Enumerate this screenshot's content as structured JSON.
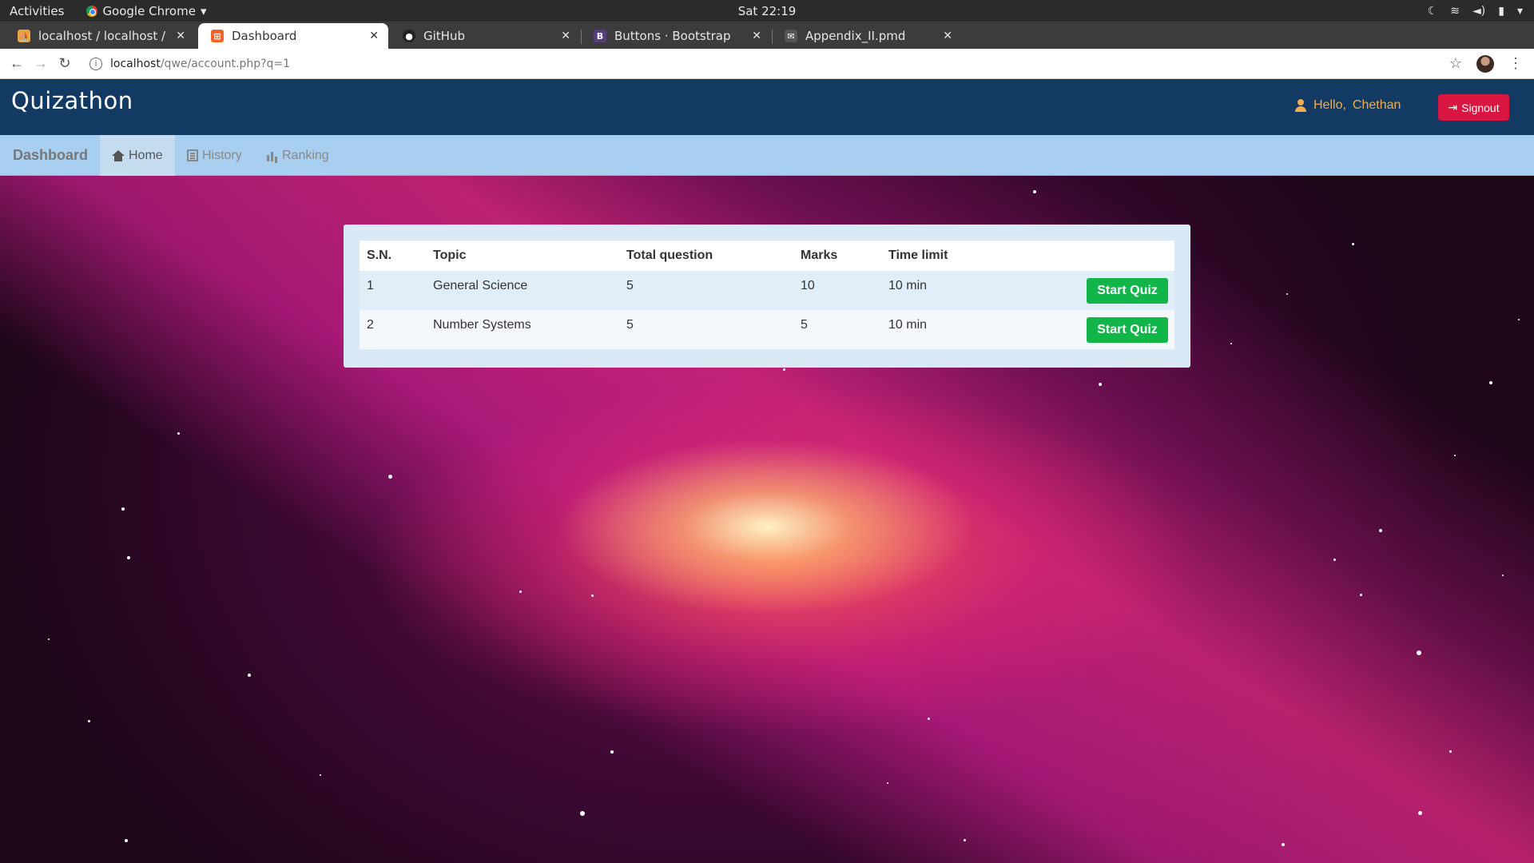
{
  "os": {
    "activities": "Activities",
    "app_name": "Google Chrome",
    "clock": "Sat 22:19"
  },
  "browser": {
    "tabs": [
      {
        "title": "localhost / localhost / pro",
        "active": false
      },
      {
        "title": "Dashboard",
        "active": true
      },
      {
        "title": "GitHub",
        "active": false
      },
      {
        "title": "Buttons · Bootstrap",
        "active": false
      },
      {
        "title": "Appendix_II.pmd",
        "active": false
      }
    ],
    "url_host": "localhost",
    "url_path": "/qwe/account.php?q=1"
  },
  "header": {
    "logo": "Quizathon",
    "hello_prefix": "Hello,",
    "username": "Chethan",
    "signout_label": "Signout"
  },
  "nav": {
    "brand": "Dashboard",
    "links": [
      {
        "label": "Home",
        "icon": "home-icon",
        "active": true
      },
      {
        "label": "History",
        "icon": "list-icon",
        "active": false
      },
      {
        "label": "Ranking",
        "icon": "bar-chart-icon",
        "active": false
      }
    ]
  },
  "quiz_table": {
    "headers": [
      "S.N.",
      "Topic",
      "Total question",
      "Marks",
      "Time limit"
    ],
    "rows": [
      {
        "sn": "1",
        "topic": "General Science",
        "total_question": "5",
        "marks": "10",
        "time_limit": "10 min",
        "action": "Start Quiz"
      },
      {
        "sn": "2",
        "topic": "Number Systems",
        "total_question": "5",
        "marks": "5",
        "time_limit": "10 min",
        "action": "Start Quiz"
      }
    ]
  },
  "colors": {
    "header_bg": "#123a63",
    "nav_bg": "#a9cff0",
    "signout_bg": "#d9163f",
    "start_button_bg": "#11b549",
    "hello_text": "#f0ad4e"
  }
}
